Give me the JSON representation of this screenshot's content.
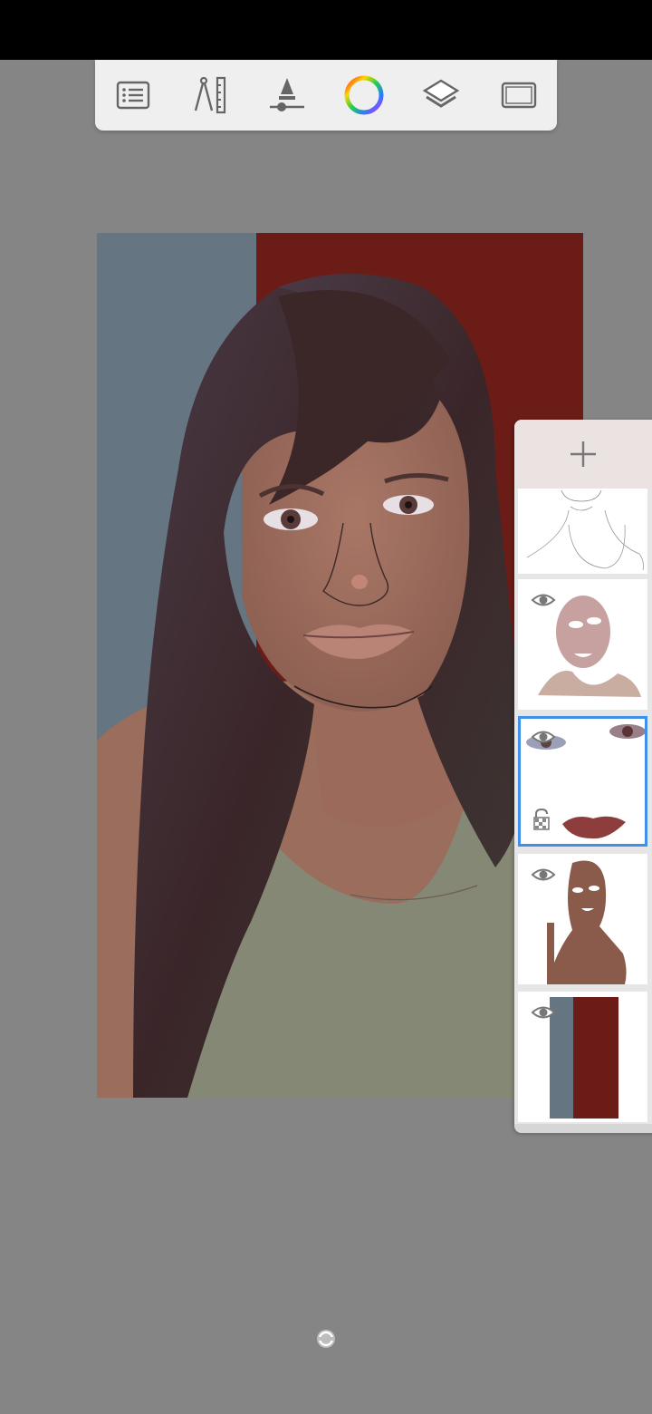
{
  "app": {
    "status_bar_color": "#000000",
    "workspace_color": "#858585"
  },
  "toolbar": {
    "background": "#efefef",
    "tools": [
      {
        "name": "lagoon-menu",
        "icon": "list-icon"
      },
      {
        "name": "ruler-tools",
        "icon": "compass-ruler-icon"
      },
      {
        "name": "brush-properties",
        "icon": "brush-size-icon"
      },
      {
        "name": "color-picker",
        "icon": "color-wheel-icon"
      },
      {
        "name": "layers",
        "icon": "layers-icon"
      },
      {
        "name": "fullscreen",
        "icon": "fullscreen-icon"
      }
    ]
  },
  "canvas": {
    "background_left": "#657582",
    "background_right": "#6b1c16",
    "skin": "#9a6d5c",
    "hair": "#3f2a2e",
    "top": "#858874"
  },
  "layers": {
    "add_icon": "plus-icon",
    "selected_color": "#3f90e8",
    "items": [
      {
        "name": "sketch-layer",
        "visible_eye": false,
        "selected": false
      },
      {
        "name": "shading-layer",
        "visible_eye": true,
        "selected": false
      },
      {
        "name": "features-layer",
        "visible_eye": true,
        "selected": true,
        "alpha_lock": true
      },
      {
        "name": "base-skin-layer",
        "visible_eye": true,
        "selected": false
      },
      {
        "name": "background-layer",
        "visible_eye": true,
        "selected": false
      }
    ]
  },
  "bottom": {
    "indicator_icon": "rotate-icon"
  }
}
